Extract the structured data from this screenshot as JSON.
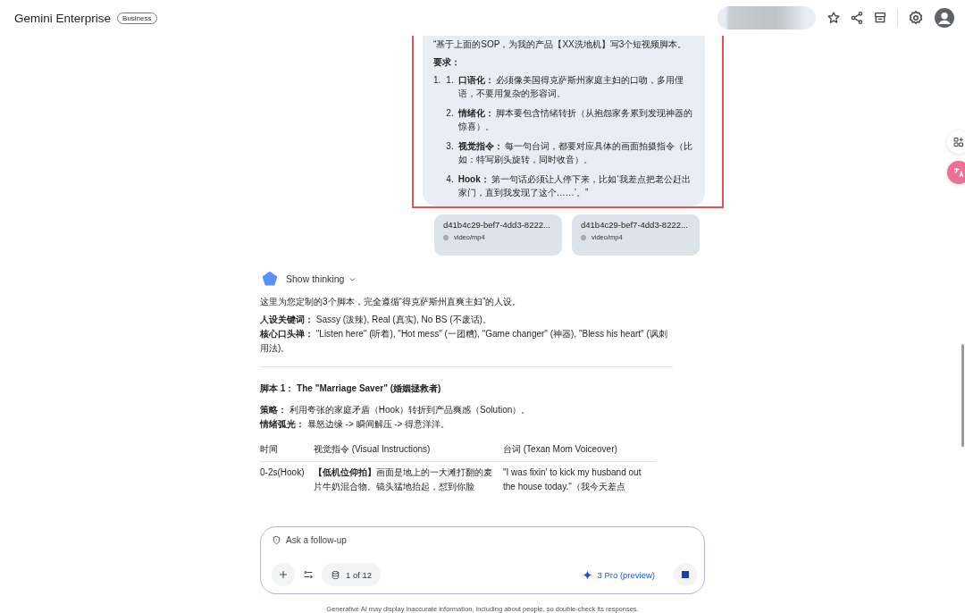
{
  "header": {
    "title": "Gemini Enterprise",
    "badge": "Business"
  },
  "prompt": {
    "intro": "“基于上面的SOP，为我的产品【XX洗地机】写3个短视频脚本。",
    "heading": "要求：",
    "outer_number": "1.",
    "items": [
      {
        "number": "1.",
        "text": "**口语化：** 必须像美国得克萨斯州家庭主妇的口吻，多用俚语，不要用复杂的形容词。"
      },
      {
        "number": "2.",
        "text": "**情绪化：** 脚本要包含情绪转折（从抱怨家务累到发现神器的惊喜）。"
      },
      {
        "number": "3.",
        "text": "**视觉指令：** 每一句台词，都要对应具体的画面拍摄指令（比如：特写刷头旋转，同时收音）。"
      },
      {
        "number": "4.",
        "text": "**Hook：** 第一句话必须让人停下来，比如‘我差点把老公赶出家门，直到我发现了这个……’。”"
      }
    ]
  },
  "attachments": [
    {
      "name": "d41b4c29-bef7-4dd3-8222...",
      "type": "video/mp4"
    },
    {
      "name": "d41b4c29-bef7-4dd3-8222...",
      "type": "video/mp4"
    }
  ],
  "response": {
    "thinking_label": "Show thinking",
    "intro": "这里为您定制的3个脚本，完全遵循“得克萨斯州直爽主妇”的人设。",
    "keywords": [
      "**人设关键词：** Sassy (泼辣), Real (真实), No BS (不废话)。",
      "**核心口头禅：** \"Listen here\" (听着), \"Hot mess\" (一团糟), \"Game changer\" (神器), \"Bless his heart\" (讽刺用法)。"
    ],
    "script_title": "脚本 1： The \"Marriage Saver\" (婚姻拯救者)",
    "script_notes": [
      "**策略：** 利用夸张的家庭矛盾（Hook）转折到产品爽感（Solution）。",
      "**情绪弧光：** 暴怒边缘 -> 瞬间解压 -> 得意洋洋。"
    ],
    "table": {
      "columns": [
        "时间",
        "视觉指令 (Visual Instructions)",
        "台词 (Texan Mom Voiceover)"
      ],
      "rows": [
        [
          "0-2s(Hook)",
          "**【低机位仰拍】**画面是地上的一大滩打翻的麦片牛奶混合物。镜头猛地抬起，怼到你脸",
          "\"I was fixin' to kick my husband out the house today.\"（我今天差点"
        ]
      ]
    }
  },
  "composer": {
    "placeholder": "Ask a follow-up",
    "source_count": "1 of 12",
    "model": "3 Pro (preview)"
  },
  "disclaimer": "Generative AI may display inaccurate information, including about people, so double-check its responses."
}
